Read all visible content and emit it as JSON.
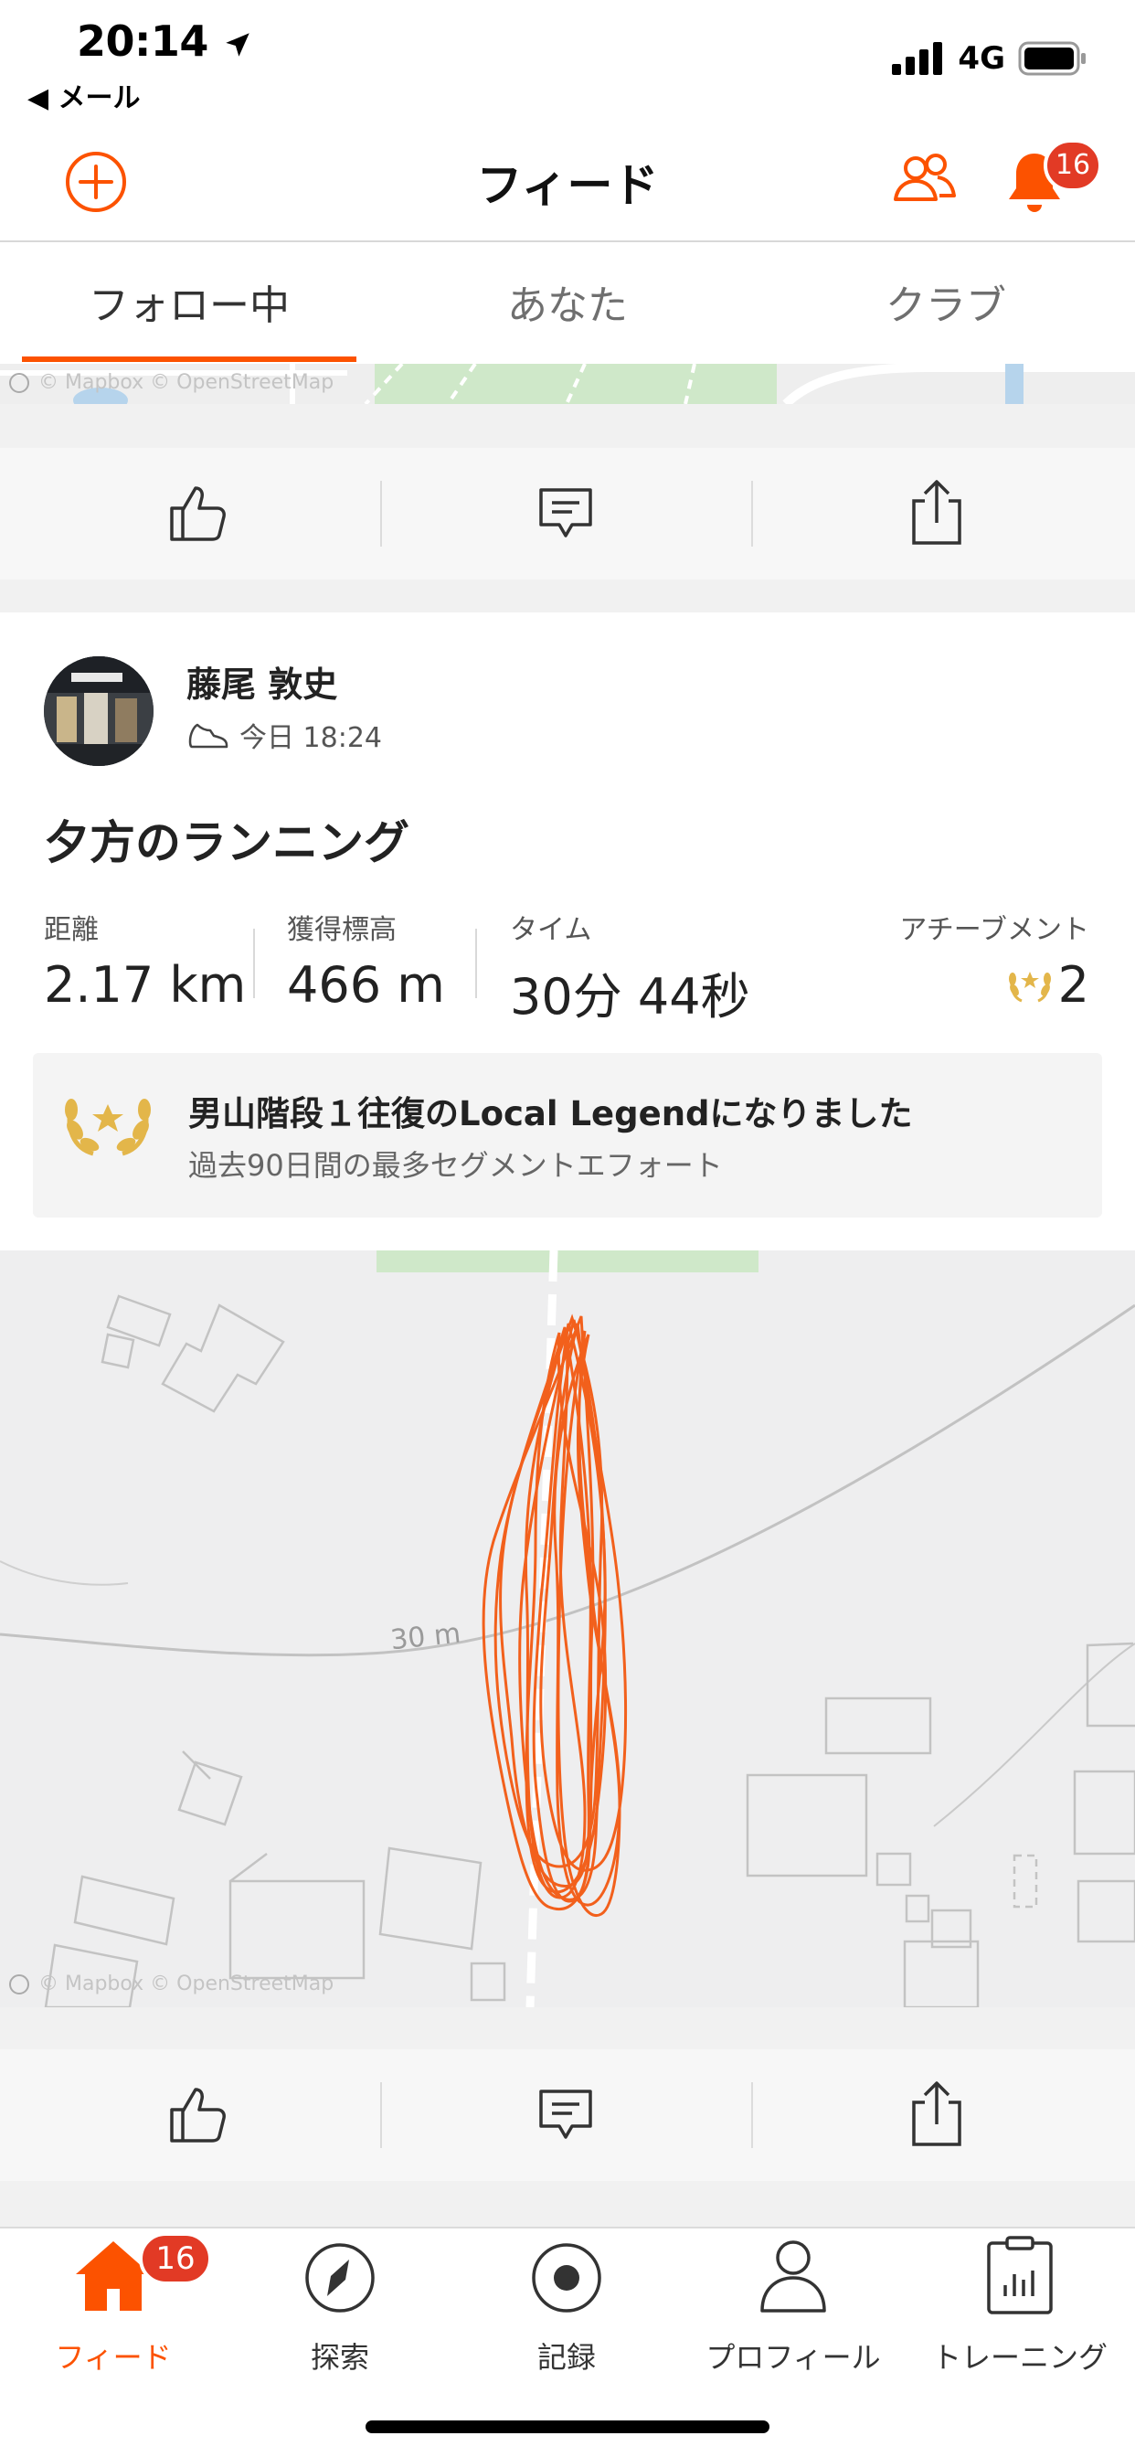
{
  "status_bar": {
    "time": "20:14",
    "back_label": "◀ メール",
    "network": "4G",
    "icons": [
      "location-arrow-icon",
      "signal-icon",
      "battery-icon"
    ]
  },
  "header": {
    "title": "フィード",
    "notification_count": "16",
    "icons": [
      "plus-circle-icon",
      "people-icon",
      "bell-icon"
    ],
    "accent_color": "#fc5200"
  },
  "tabs": [
    {
      "label": "フォロー中",
      "active": true
    },
    {
      "label": "あなた",
      "active": false
    },
    {
      "label": "クラブ",
      "active": false
    }
  ],
  "map_attribution": "© Mapbox © OpenStreetMap",
  "activity": {
    "athlete": "藤尾 敦史",
    "time": "今日 18:24",
    "title": "夕方のランニング",
    "stats": [
      {
        "label": "距離",
        "value": "2.17 km"
      },
      {
        "label": "獲得標高",
        "value": "466 m"
      },
      {
        "label": "タイム",
        "value": "30分 44秒"
      },
      {
        "label": "アチーブメント",
        "value": "2"
      }
    ],
    "legend": {
      "title": "男山階段１往復のLocal Legendになりました",
      "subtitle": "過去90日間の最多セグメントエフォート"
    },
    "map_contour_label": "30 m",
    "route_color": "#f2601c"
  },
  "action_icons": [
    "thumbs-up-icon",
    "comment-icon",
    "share-icon"
  ],
  "bottom_nav": {
    "items": [
      {
        "label": "フィード",
        "icon": "home-icon",
        "active": true
      },
      {
        "label": "探索",
        "icon": "compass-icon",
        "active": false
      },
      {
        "label": "記録",
        "icon": "record-icon",
        "active": false
      },
      {
        "label": "プロフィール",
        "icon": "profile-icon",
        "active": false
      },
      {
        "label": "トレーニング",
        "icon": "training-icon",
        "active": false
      }
    ],
    "badge": "16"
  }
}
